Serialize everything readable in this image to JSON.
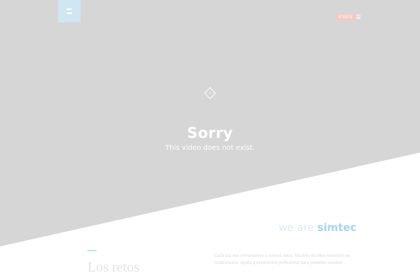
{
  "header": {
    "language_label": "ES/EN",
    "logo_icon": "simtec-logo-icon",
    "menu_icon": "hamburger-menu-icon"
  },
  "video_error": {
    "play_icon": "play-diamond-icon",
    "title": "Sorry",
    "message": "This video does not exist."
  },
  "brand": {
    "prefix": "we are ",
    "name": "simtec"
  },
  "content": {
    "headline": "Los retos",
    "body": "Cada día nos enfrentamos a nuevos retos. Muchos de ellos necesitan de colaboración, ayuda y experiencia profesional para poderlos resolver."
  },
  "colors": {
    "video_background": "#d6d6d6",
    "logo_background": "#cfe6f3",
    "language_pill": "#f6c9c0",
    "brand_accent": "#a6d5ee"
  }
}
